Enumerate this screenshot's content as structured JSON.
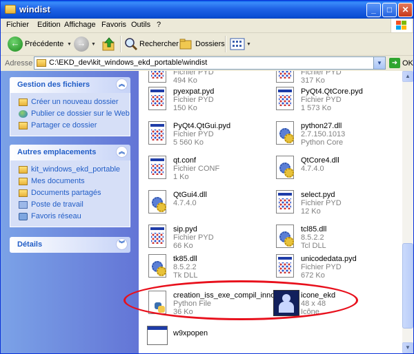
{
  "window": {
    "title": "windist"
  },
  "menu": [
    "Fichier",
    "Edition",
    "Affichage",
    "Favoris",
    "Outils",
    "?"
  ],
  "toolbar": {
    "back": "Précédente",
    "search": "Rechercher",
    "folders": "Dossiers"
  },
  "address": {
    "label": "Adresse",
    "path": "C:\\EKD_dev\\kit_windows_ekd_portable\\windist",
    "go": "OK"
  },
  "tasks": {
    "title": "Gestion des fichiers",
    "items": [
      "Créer un nouveau dossier",
      "Publier ce dossier sur le Web",
      "Partager ce dossier"
    ]
  },
  "places": {
    "title": "Autres emplacements",
    "items": [
      "kit_windows_ekd_portable",
      "Mes documents",
      "Documents partagés",
      "Poste de travail",
      "Favoris réseau"
    ]
  },
  "details": {
    "title": "Détails"
  },
  "files": [
    {
      "name": "",
      "type": "Fichier PYD",
      "size": "494 Ko",
      "icon": "pyd"
    },
    {
      "name": "",
      "type": "Fichier PYD",
      "size": "317 Ko",
      "icon": "pyd"
    },
    {
      "name": "pyexpat.pyd",
      "type": "Fichier PYD",
      "size": "150 Ko",
      "icon": "pyd"
    },
    {
      "name": "PyQt4.QtCore.pyd",
      "type": "Fichier PYD",
      "size": "1 573 Ko",
      "icon": "pyd"
    },
    {
      "name": "PyQt4.QtGui.pyd",
      "type": "Fichier PYD",
      "size": "5 560 Ko",
      "icon": "pyd"
    },
    {
      "name": "python27.dll",
      "type": "2.7.150.1013",
      "size": "Python Core",
      "icon": "dll"
    },
    {
      "name": "qt.conf",
      "type": "Fichier CONF",
      "size": "1 Ko",
      "icon": "pyd"
    },
    {
      "name": "QtCore4.dll",
      "type": "4.7.4.0",
      "size": "",
      "icon": "dll"
    },
    {
      "name": "QtGui4.dll",
      "type": "4.7.4.0",
      "size": "",
      "icon": "dll"
    },
    {
      "name": "select.pyd",
      "type": "Fichier PYD",
      "size": "12 Ko",
      "icon": "pyd"
    },
    {
      "name": "sip.pyd",
      "type": "Fichier PYD",
      "size": "66 Ko",
      "icon": "pyd"
    },
    {
      "name": "tcl85.dll",
      "type": "8.5.2.2",
      "size": "Tcl DLL",
      "icon": "dll"
    },
    {
      "name": "tk85.dll",
      "type": "8.5.2.2",
      "size": "Tk DLL",
      "icon": "dll"
    },
    {
      "name": "unicodedata.pyd",
      "type": "Fichier PYD",
      "size": "672 Ko",
      "icon": "pyd"
    },
    {
      "name": "creation_iss_exe_compil_inno...",
      "type": "Python File",
      "size": "36 Ko",
      "icon": "py"
    },
    {
      "name": "icone_ekd",
      "type": "48 x 48",
      "size": "Icône",
      "icon": "image"
    },
    {
      "name": "w9xpopen",
      "type": "",
      "size": "",
      "icon": "exe"
    }
  ],
  "colors": {
    "titlebar": "#0A5DE8",
    "task_link": "#215DC6",
    "annotation": "#E8101C"
  }
}
